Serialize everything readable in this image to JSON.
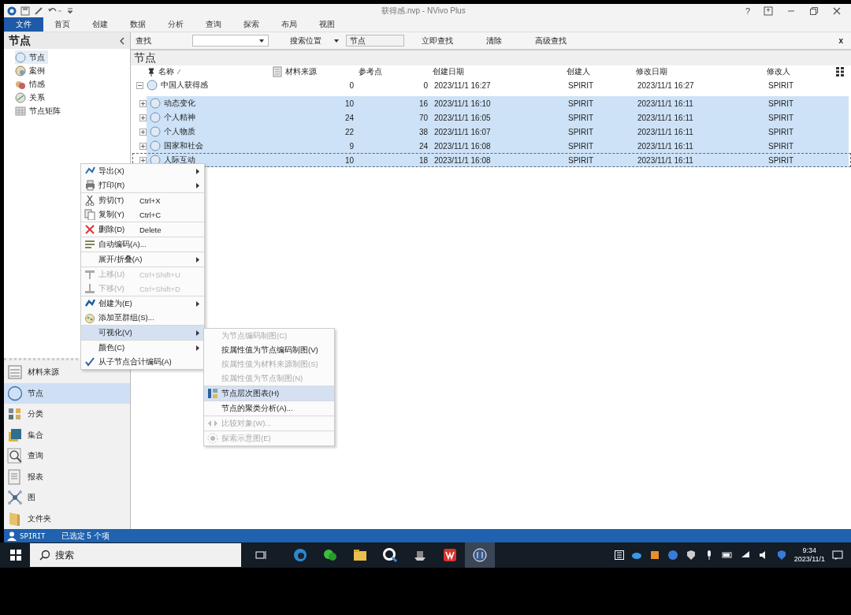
{
  "window": {
    "title": "获得感.nvp - NVivo Plus",
    "help_label": "?"
  },
  "ribbon_tabs": [
    {
      "label": "文件",
      "selected": true
    },
    {
      "label": "首页",
      "selected": false
    },
    {
      "label": "创建",
      "selected": false
    },
    {
      "label": "数据",
      "selected": false
    },
    {
      "label": "分析",
      "selected": false
    },
    {
      "label": "查询",
      "selected": false
    },
    {
      "label": "探索",
      "selected": false
    },
    {
      "label": "布局",
      "selected": false
    },
    {
      "label": "视图",
      "selected": false
    }
  ],
  "sidebar": {
    "title": "节点",
    "items": [
      {
        "label": "节点",
        "selected": true
      },
      {
        "label": "案例",
        "selected": false
      },
      {
        "label": "情感",
        "selected": false
      },
      {
        "label": "关系",
        "selected": false
      },
      {
        "label": "节点矩阵",
        "selected": false
      }
    ]
  },
  "find_bar": {
    "label": "查找",
    "search_in_label": "搜索位置",
    "search_in_value": "节点",
    "buttons": [
      "立即查找",
      "清除",
      "高级查找"
    ],
    "close_label": "x"
  },
  "table": {
    "title": "节点",
    "columns": [
      "名称",
      "材料来源",
      "参考点",
      "创建日期",
      "创建人",
      "修改日期",
      "修改人"
    ],
    "rows": [
      {
        "name": "中国人获得感",
        "values": [
          "0",
          "0",
          "2023/11/1 16:27",
          "SPIRIT",
          "2023/11/1 16:27",
          "SPIRIT"
        ],
        "expanded": true,
        "selected": false,
        "focused": false,
        "children": [
          {
            "name": "动态变化",
            "values": [
              "10",
              "16",
              "2023/11/1 16:10",
              "SPIRIT",
              "2023/11/1 16:11",
              "SPIRIT"
            ],
            "expanded": false,
            "selected": true,
            "focused": false
          },
          {
            "name": "个人精神",
            "values": [
              "24",
              "70",
              "2023/11/1 16:05",
              "SPIRIT",
              "2023/11/1 16:11",
              "SPIRIT"
            ],
            "expanded": false,
            "selected": true,
            "focused": false
          },
          {
            "name": "个人物质",
            "values": [
              "22",
              "38",
              "2023/11/1 16:07",
              "SPIRIT",
              "2023/11/1 16:11",
              "SPIRIT"
            ],
            "expanded": false,
            "selected": true,
            "focused": false
          },
          {
            "name": "国家和社会",
            "values": [
              "9",
              "24",
              "2023/11/1 16:08",
              "SPIRIT",
              "2023/11/1 16:11",
              "SPIRIT"
            ],
            "expanded": false,
            "selected": true,
            "focused": false
          },
          {
            "name": "人际互动",
            "values": [
              "10",
              "18",
              "2023/11/1 16:08",
              "SPIRIT",
              "2023/11/1 16:11",
              "SPIRIT"
            ],
            "expanded": false,
            "selected": true,
            "focused": true
          }
        ]
      }
    ]
  },
  "context_menu": {
    "groups": [
      [
        {
          "label": "导出(X)",
          "submenu": true,
          "disabled": false,
          "selected": false,
          "checked": false
        },
        {
          "label": "打印(R)",
          "submenu": true,
          "disabled": false,
          "selected": false,
          "checked": false
        }
      ],
      [
        {
          "label": "剪切(T)",
          "shortcut": "Ctrl+X",
          "submenu": false,
          "disabled": false,
          "selected": false,
          "checked": false
        },
        {
          "label": "复制(Y)",
          "shortcut": "Ctrl+C",
          "submenu": false,
          "disabled": false,
          "selected": false,
          "checked": false
        }
      ],
      [
        {
          "label": "删除(D)",
          "shortcut": "Delete",
          "submenu": false,
          "disabled": false,
          "selected": false,
          "checked": false
        }
      ],
      [
        {
          "label": "自动编码(A)...",
          "submenu": false,
          "disabled": false,
          "selected": false,
          "checked": false
        }
      ],
      [
        {
          "label": "展开/折叠(A)",
          "submenu": true,
          "disabled": false,
          "selected": false,
          "checked": false
        }
      ],
      [
        {
          "label": "上移(U)",
          "shortcut": "Ctrl+Shift+U",
          "submenu": false,
          "disabled": true,
          "selected": false,
          "checked": false
        },
        {
          "label": "下移(V)",
          "shortcut": "Ctrl+Shift+D",
          "submenu": false,
          "disabled": true,
          "selected": false,
          "checked": false
        }
      ],
      [
        {
          "label": "创建为(E)",
          "submenu": true,
          "disabled": false,
          "selected": false,
          "checked": false
        },
        {
          "label": "添加至群组(S)...",
          "submenu": false,
          "disabled": false,
          "selected": false,
          "checked": false
        }
      ],
      [
        {
          "label": "可视化(V)",
          "submenu": true,
          "disabled": false,
          "selected": true,
          "checked": false
        }
      ],
      [
        {
          "label": "颜色(C)",
          "submenu": true,
          "disabled": false,
          "selected": false,
          "checked": false
        },
        {
          "label": "从子节点合计编码(A)",
          "submenu": false,
          "disabled": false,
          "selected": false,
          "checked": true
        }
      ]
    ]
  },
  "submenu": {
    "groups": [
      [
        {
          "label": "为节点编码制图(C)",
          "disabled": true,
          "selected": false
        },
        {
          "label": "按属性值为节点编码制图(V)",
          "disabled": false,
          "selected": false
        },
        {
          "label": "按属性值为材料来源制图(S)",
          "disabled": true,
          "selected": false
        },
        {
          "label": "按属性值为节点制图(N)",
          "disabled": true,
          "selected": false
        }
      ],
      [
        {
          "label": "节点层次图表(H)",
          "disabled": false,
          "selected": true
        }
      ],
      [
        {
          "label": "节点的聚类分析(A)...",
          "disabled": false,
          "selected": false
        }
      ],
      [
        {
          "label": "比较对象(W)...",
          "disabled": true,
          "selected": false
        }
      ],
      [
        {
          "label": "探索示意图(E)",
          "disabled": true,
          "selected": false
        }
      ]
    ]
  },
  "navigation": [
    {
      "label": "材料来源",
      "selected": false
    },
    {
      "label": "节点",
      "selected": true
    },
    {
      "label": "分类",
      "selected": false
    },
    {
      "label": "集合",
      "selected": false
    },
    {
      "label": "查询",
      "selected": false
    },
    {
      "label": "报表",
      "selected": false
    },
    {
      "label": "图",
      "selected": false
    },
    {
      "label": "文件夹",
      "selected": false
    }
  ],
  "status_bar": {
    "user": "SPIRIT",
    "selection": "已选定 5 个项"
  },
  "taskbar": {
    "search_placeholder": "搜索",
    "time": "9:34",
    "date": "2023/11/1"
  }
}
